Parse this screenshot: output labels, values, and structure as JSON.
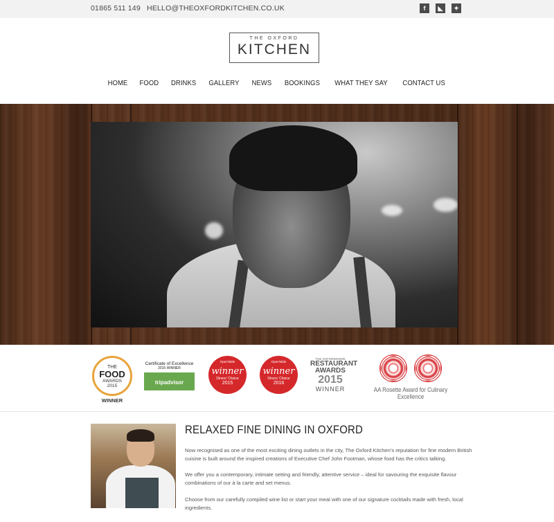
{
  "topbar": {
    "phone": "01865 511 149",
    "email": "HELLO@THEOXFORDKITCHEN.CO.UK",
    "social": [
      {
        "icon": "facebook-icon",
        "glyph": "f"
      },
      {
        "icon": "rss-icon",
        "glyph": "◣"
      },
      {
        "icon": "twitter-icon",
        "glyph": "✦"
      }
    ]
  },
  "logo": {
    "small": "THE OXFORD",
    "big": "KITCHEN"
  },
  "nav": {
    "items": [
      "HOME",
      "FOOD",
      "DRINKS",
      "GALLERY",
      "NEWS",
      "BOOKINGS",
      "WHAT THEY SAY",
      "CONTACT US"
    ]
  },
  "awards": {
    "food": {
      "line1": "THE",
      "line2": "FOOD",
      "line3": "AWARDS",
      "year": "2015",
      "winner": "WINNER"
    },
    "tripadvisor": {
      "title": "Certificate of Excellence",
      "subtitle": "2015 WINNER",
      "brand": "tripadvisor"
    },
    "opentable1": {
      "brand": "OpenTable",
      "label": "winner",
      "sub": "Diners' Choice",
      "year": "2015"
    },
    "opentable2": {
      "brand": "OpenTable",
      "label": "winner",
      "sub": "Diners' Choice",
      "year": "2016"
    },
    "restaurant": {
      "line1": "THE OXFORDSHIRE",
      "line2": "RESTAURANT",
      "line3": "AWARDS",
      "year": "2015",
      "winner": "WINNER"
    },
    "aa": {
      "caption": "AA Rosette Award for Culinary Excellence"
    }
  },
  "intro": {
    "title": "RELAXED FINE DINING IN OXFORD",
    "p1": "Now recognised as one of the most exciting dining outlets in the city, The Oxford Kitchen's reputation for fine modern British cuisine is built around the inspired creations of Executive Chef John Footman, whose food has the critics talking.",
    "p2": "We offer you a contemporary, intimate setting and friendly, attentive service – ideal for savouring the exquisite flavour combinations of our à la carte and set menus.",
    "p3": "Choose from our carefully compiled wine list or start your meal with one of our signature cocktails made with fresh, local ingredients."
  },
  "colors": {
    "topbar_bg": "#f2f2f2",
    "wood": "#4a2a18",
    "opentable_red": "#d5282b",
    "tripadvisor_green": "#6aa84f",
    "aa_red": "#d21f24"
  }
}
